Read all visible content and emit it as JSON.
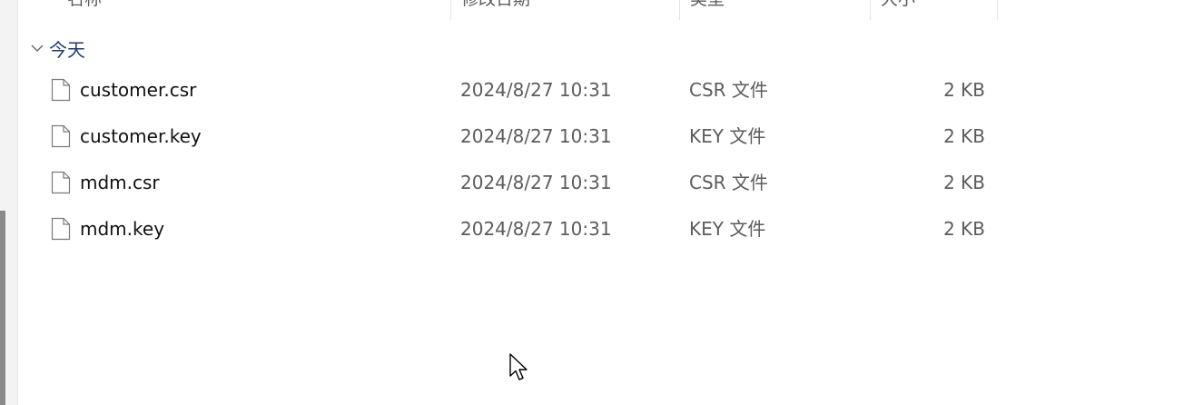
{
  "columns": {
    "name": "名称",
    "modified": "修改日期",
    "type": "类型",
    "size": "大小"
  },
  "group": {
    "label": "今天",
    "expanded": true,
    "icon": "chevron-down-icon"
  },
  "files": [
    {
      "name": "customer.csr",
      "modified": "2024/8/27 10:31",
      "type": "CSR 文件",
      "size": "2 KB",
      "icon": "file-icon"
    },
    {
      "name": "customer.key",
      "modified": "2024/8/27 10:31",
      "type": "KEY 文件",
      "size": "2 KB",
      "icon": "file-icon"
    },
    {
      "name": "mdm.csr",
      "modified": "2024/8/27 10:31",
      "type": "CSR 文件",
      "size": "2 KB",
      "icon": "file-icon"
    },
    {
      "name": "mdm.key",
      "modified": "2024/8/27 10:31",
      "type": "KEY 文件",
      "size": "2 KB",
      "icon": "file-icon"
    }
  ],
  "colors": {
    "group_label": "#1f3a70",
    "primary_text": "#111111",
    "secondary_text": "#5c5c5c"
  }
}
